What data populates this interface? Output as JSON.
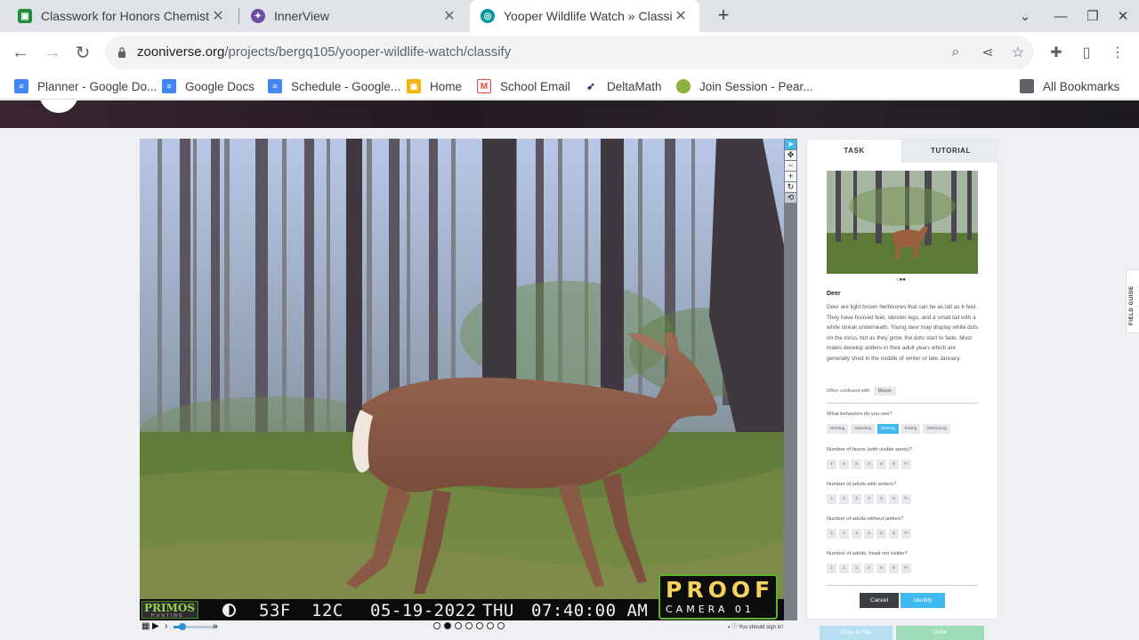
{
  "tabs": [
    {
      "title": "Classwork for Honors Chemistry",
      "icon": "classroom-icon",
      "color": "#1e8e3e"
    },
    {
      "title": "InnerView",
      "icon": "innerview-icon",
      "color": "#6b4ea0"
    },
    {
      "title": "Yooper Wildlife Watch » Classify",
      "icon": "zooniverse-icon",
      "color": "#00979d"
    }
  ],
  "address_bar": {
    "domain": "zooniverse.org",
    "path": "/projects/bergq105/yooper-wildlife-watch/classify"
  },
  "bookmarks": [
    {
      "label": "Planner - Google Do...",
      "icon": "google-docs-icon",
      "color": "#4285f4"
    },
    {
      "label": "Google Docs",
      "icon": "google-docs-icon",
      "color": "#4285f4"
    },
    {
      "label": "Schedule - Google...",
      "icon": "google-docs-icon",
      "color": "#4285f4"
    },
    {
      "label": "Home",
      "icon": "classroom-icon",
      "color": "#f4b400"
    },
    {
      "label": "School Email",
      "icon": "gmail-icon",
      "color": "#ea4335"
    },
    {
      "label": "DeltaMath",
      "icon": "deltamath-icon",
      "color": "#2b2b6b"
    },
    {
      "label": "Join Session - Pear...",
      "icon": "pear-icon",
      "color": "#8bb33a"
    }
  ],
  "all_bookmarks": "All Bookmarks",
  "camera_stamp": {
    "brand": "PRIMOS",
    "brand_sub": "HUNTING",
    "temp_f": "53F",
    "temp_c": "12C",
    "date": "05-19-2022",
    "day": "THU",
    "time": "07:40:00 AM",
    "proof": "PROOF",
    "camera": "CAMERA 01"
  },
  "player": {
    "frames": 7,
    "current_frame": 2,
    "signin_note": "You should sign in!"
  },
  "task_panel": {
    "tab_task": "TASK",
    "tab_tutorial": "TUTORIAL",
    "species": "Deer",
    "description": "Deer are light brown herbivores that can be as tall as 6 feet. They have hooved feet, slender legs, and a small tail with a white streak underneath. Young deer may display white dots on the torso, but as they grow, the dots start to fade. Most males develop antlers in their adult years which are generally shed in the middle of winter or late January.",
    "confused_label": "Often confused with",
    "confused_with": "Moose",
    "behavior_question": "What behaviors do you see?",
    "behaviors": [
      "Resting",
      "Standing",
      "Moving",
      "Eating",
      "Interacting"
    ],
    "selected_behavior": "Moving",
    "count_questions": [
      "Number of fawns (with visible spots)?",
      "Number of adults with antlers?",
      "Number of adults without antlers?",
      "Number of adults, head not visible?"
    ],
    "count_options": [
      "1",
      "2",
      "3",
      "4",
      "5",
      "6",
      "7+"
    ],
    "cancel": "Cancel",
    "identify": "Identify",
    "done_talk": "Done & Talk",
    "done": "Done"
  },
  "field_guide": "FIELD GUIDE",
  "colors": {
    "accent": "#3fb9f0",
    "tabstrip": "#dfe3e8",
    "done_talk": "#b7dff2",
    "done": "#9fdcb9"
  }
}
